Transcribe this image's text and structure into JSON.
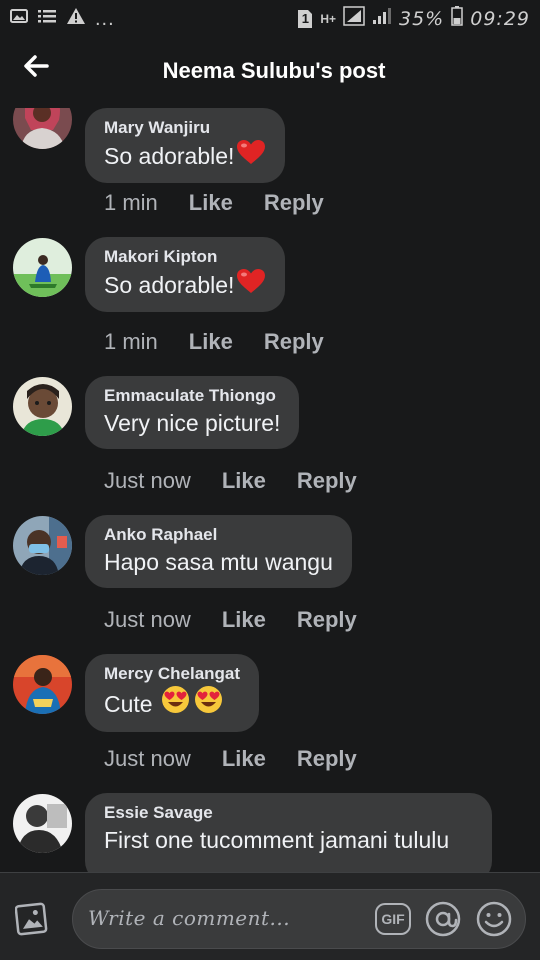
{
  "status_bar": {
    "left_icons": [
      "image-icon",
      "list-icon",
      "warning-icon"
    ],
    "dots": "...",
    "sim_label": "1",
    "network_label": "H+",
    "battery": "35%",
    "time": "09:29"
  },
  "header": {
    "back_icon": "arrow-left-icon",
    "title": "Neema Sulubu's post"
  },
  "comments": [
    {
      "author": "Mary Wanjiru",
      "text": "So adorable!",
      "emoji": [
        "red-heart"
      ],
      "time": "1 min",
      "like": "Like",
      "reply": "Reply"
    },
    {
      "author": "Makori Kipton",
      "text": "So adorable!",
      "emoji": [
        "red-heart"
      ],
      "time": "1 min",
      "like": "Like",
      "reply": "Reply"
    },
    {
      "author": "Emmaculate Thiongo",
      "text": "Very nice picture!",
      "emoji": [],
      "time": "Just now",
      "like": "Like",
      "reply": "Reply"
    },
    {
      "author": "Anko Raphael",
      "text": "Hapo sasa mtu wangu",
      "emoji": [],
      "time": "Just now",
      "like": "Like",
      "reply": "Reply"
    },
    {
      "author": "Mercy Chelangat",
      "text": "Cute",
      "emoji": [
        "heart-eyes",
        "heart-eyes"
      ],
      "time": "Just now",
      "like": "Like",
      "reply": "Reply"
    },
    {
      "author": "Essie Savage",
      "text": "First one tucomment jamani tululu",
      "emoji": [],
      "time": "",
      "like": "",
      "reply": ""
    }
  ],
  "composer": {
    "photo_icon": "photo-icon",
    "placeholder": "Write a comment...",
    "gif_label": "GIF",
    "mention_icon": "at-icon",
    "emoji_icon": "smiley-icon"
  },
  "colors": {
    "background": "#18191a",
    "bubble": "#3a3b3c",
    "composer": "#242526",
    "heart": "#e02424"
  }
}
